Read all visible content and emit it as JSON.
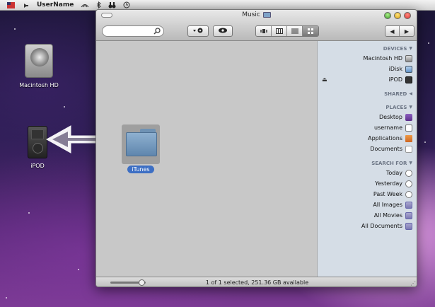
{
  "menubar": {
    "username": "UserName",
    "icons": [
      "clock-icon",
      "binoculars-icon",
      "bluetooth-icon",
      "wifi-icon",
      "volume-icon",
      "flag-icon"
    ]
  },
  "desktop": {
    "hd_label": "Macintosh HD",
    "ipod_label": "iPOD"
  },
  "window": {
    "title": "Music",
    "selected_item": "iTunes",
    "status": "1 of 1 selected, 251.36 GB available",
    "sidebar": {
      "devices": {
        "title": "DEVICES",
        "items": [
          "Macintosh HD",
          "iDisk",
          "iPOD"
        ]
      },
      "shared": {
        "title": "SHARED"
      },
      "places": {
        "title": "PLACES",
        "items": [
          "Desktop",
          "username",
          "Applications",
          "Documents"
        ]
      },
      "search_for": {
        "title": "SEARCH FOR",
        "items": [
          "Today",
          "Yesterday",
          "Past Week",
          "All Images",
          "All Movies",
          "All Documents"
        ]
      }
    }
  },
  "colors": {
    "selection": "#3d6fc4",
    "sidebar_bg": "#d5dde6"
  }
}
